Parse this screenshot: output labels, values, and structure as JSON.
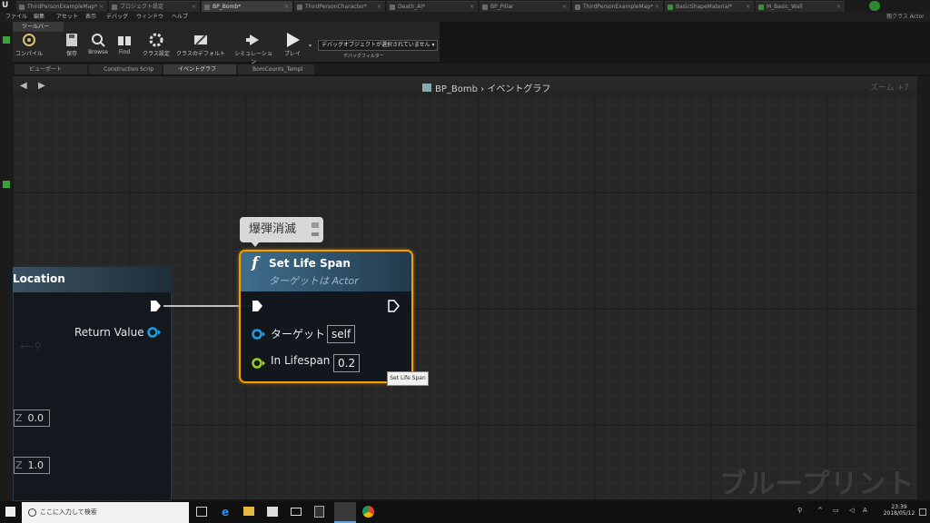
{
  "tabs": [
    {
      "label": "ThirdPersonExampleMap*"
    },
    {
      "label": "プロジェクト設定"
    },
    {
      "label": "BP_Bomb*"
    },
    {
      "label": "ThirdPersonCharacter*"
    },
    {
      "label": "Death_AI*"
    },
    {
      "label": "BP_Pillar"
    },
    {
      "label": "ThirdPersonExampleMap*"
    },
    {
      "label": "BasicShapeMaterial*"
    },
    {
      "label": "M_Basic_Wall"
    }
  ],
  "parent_class": "親クラス Actor",
  "menu": [
    "ファイル",
    "編集",
    "アセット",
    "表示",
    "デバッグ",
    "ウィンドウ",
    "ヘルプ"
  ],
  "toolbar": {
    "header": "ツールバー",
    "buttons": [
      {
        "label": "コンパイル"
      },
      {
        "label": "保存"
      },
      {
        "label": "Browse"
      },
      {
        "label": "Find"
      },
      {
        "label": "クラス設定"
      },
      {
        "label": "クラスのデフォルト"
      },
      {
        "label": "シミュレーション"
      },
      {
        "label": "プレイ"
      }
    ],
    "debug_select": "デバッグオブジェクトが選択されていません ▾",
    "debug_label": "デバッグフィルター"
  },
  "subtabs": [
    {
      "label": "ビューポート"
    },
    {
      "label": "Construction Scrip"
    },
    {
      "label": "イベントグラフ"
    },
    {
      "label": "BomCounts_Templ"
    }
  ],
  "graph": {
    "breadcrumb_class": "BP_Bomb",
    "breadcrumb_sep": "›",
    "breadcrumb_graph": "イベントグラフ",
    "zoom": "ズーム +7",
    "watermark": "ブループリント"
  },
  "left_node": {
    "title": "Location",
    "return_label": "Return Value",
    "vectors": [
      {
        "axis": "Z",
        "value": "0.0"
      },
      {
        "axis": "Z",
        "value": "1.0"
      }
    ]
  },
  "node": {
    "comment": "爆弾消滅",
    "title": "Set Life Span",
    "subtitle": "ターゲットは Actor",
    "target_label": "ターゲット",
    "target_value": "self",
    "lifespan_label": "In Lifespan",
    "lifespan_value": "0.2",
    "tooltip": "Set Life Span"
  },
  "taskbar": {
    "search_placeholder": "ここに入力して検索",
    "time": "23:39",
    "date": "2018/05/12"
  },
  "colors": {
    "accent_orange": "#f3a100",
    "node_head": "#3f6e8d",
    "exec_pin": "#ffffff",
    "object_pin": "#1aa0e6",
    "float_pin": "#9ad11b"
  }
}
